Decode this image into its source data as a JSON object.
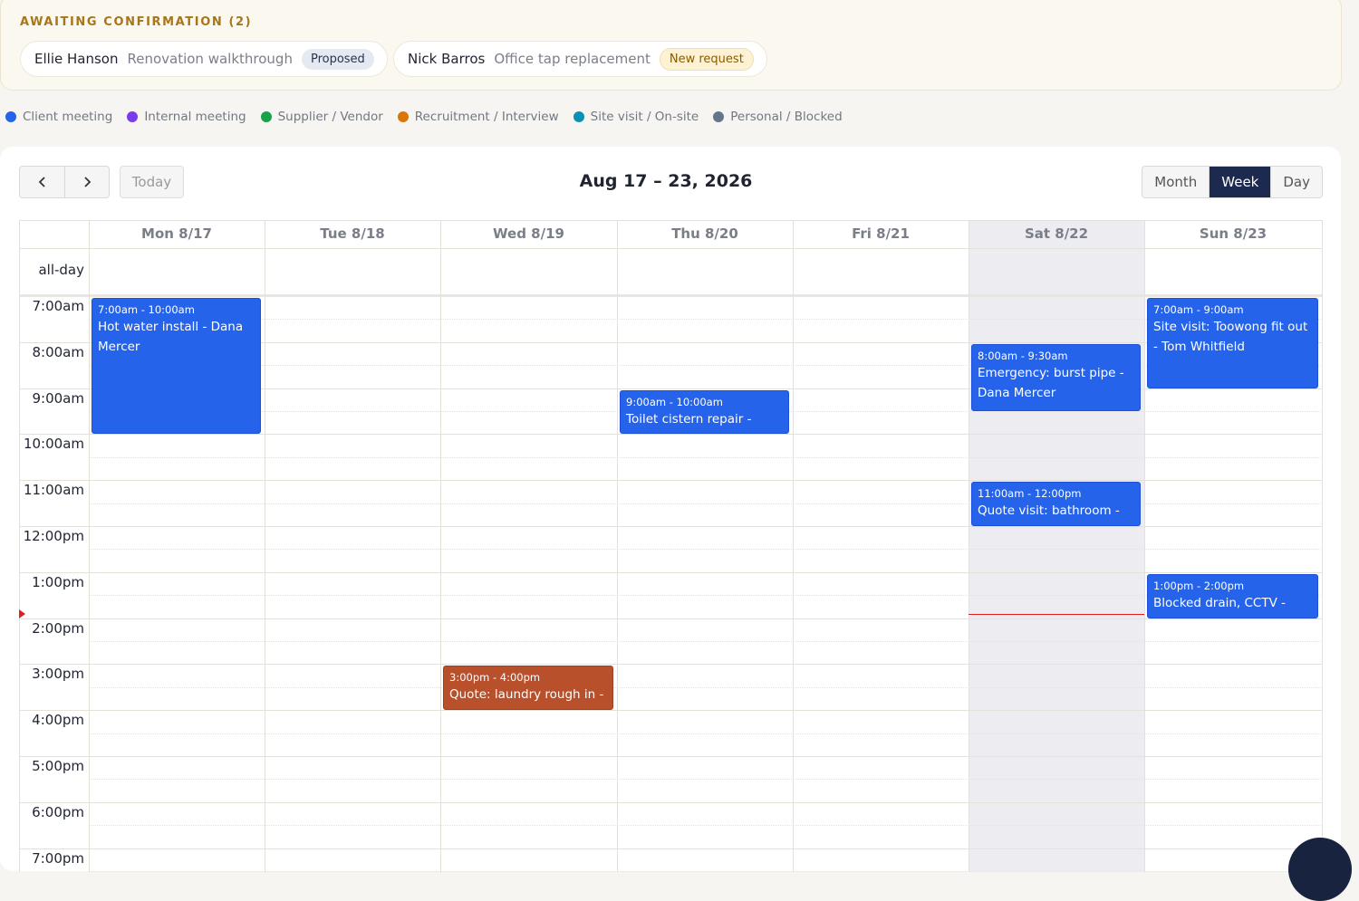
{
  "awaiting": {
    "title": "AWAITING CONFIRMATION (2)",
    "requests": [
      {
        "name": "Ellie Hanson",
        "description": "Renovation walkthrough",
        "status": "Proposed"
      },
      {
        "name": "Nick Barros",
        "description": "Office tap replacement",
        "status": "New request"
      }
    ]
  },
  "legend": [
    {
      "label": "Client meeting",
      "color": "#2563eb"
    },
    {
      "label": "Internal meeting",
      "color": "#7c3aed"
    },
    {
      "label": "Supplier / Vendor",
      "color": "#16a34a"
    },
    {
      "label": "Recruitment / Interview",
      "color": "#d97706"
    },
    {
      "label": "Site visit / On-site",
      "color": "#0891b2"
    },
    {
      "label": "Personal / Blocked",
      "color": "#64748b"
    }
  ],
  "toolbar": {
    "prev_icon": "chevron-left-icon",
    "next_icon": "chevron-right-icon",
    "today_label": "Today",
    "range_title": "Aug 17 – 23, 2026",
    "views": [
      "Month",
      "Week",
      "Day"
    ],
    "active_view": "Week"
  },
  "calendar": {
    "days": [
      "Mon 8/17",
      "Tue 8/18",
      "Wed 8/19",
      "Thu 8/20",
      "Fri 8/21",
      "Sat 8/22",
      "Sun 8/23"
    ],
    "highlighted_day": "Sat 8/22",
    "allday_label": "all-day",
    "time_slots": [
      "7:00am",
      "8:00am",
      "9:00am",
      "10:00am",
      "11:00am",
      "12:00pm",
      "1:00pm",
      "2:00pm",
      "3:00pm",
      "4:00pm",
      "5:00pm",
      "6:00pm",
      "7:00pm"
    ],
    "now_time": "1:55pm",
    "events": [
      {
        "day": 0,
        "start": 7.0,
        "end": 10.0,
        "time": "7:00am - 10:00am",
        "title": "Hot water install - Dana Mercer",
        "color": "#2563eb"
      },
      {
        "day": 3,
        "start": 9.0,
        "end": 10.0,
        "time": "9:00am - 10:00am",
        "title": "Toilet cistern repair -",
        "color": "#2563eb"
      },
      {
        "day": 5,
        "start": 8.0,
        "end": 9.5,
        "time": "8:00am - 9:30am",
        "title": "Emergency: burst pipe - Dana Mercer",
        "color": "#2563eb"
      },
      {
        "day": 5,
        "start": 11.0,
        "end": 12.0,
        "time": "11:00am - 12:00pm",
        "title": "Quote visit: bathroom -",
        "color": "#2563eb"
      },
      {
        "day": 6,
        "start": 7.0,
        "end": 9.0,
        "time": "7:00am - 9:00am",
        "title": "Site visit: Toowong fit out - Tom Whitfield",
        "color": "#2563eb"
      },
      {
        "day": 6,
        "start": 13.0,
        "end": 14.0,
        "time": "1:00pm - 2:00pm",
        "title": "Blocked drain, CCTV -",
        "color": "#2563eb"
      },
      {
        "day": 2,
        "start": 15.0,
        "end": 16.0,
        "time": "3:00pm - 4:00pm",
        "title": "Quote: laundry rough in -",
        "color": "#b8502c"
      }
    ]
  }
}
